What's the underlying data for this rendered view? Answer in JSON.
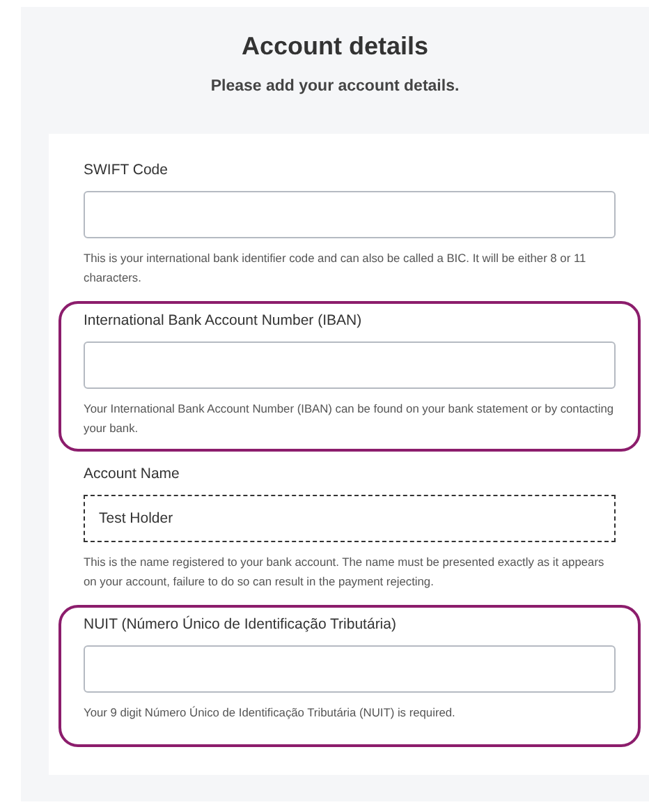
{
  "title": "Account details",
  "subtitle": "Please add your account details.",
  "fields": [
    {
      "label": "SWIFT Code",
      "help": "This is your international bank identifier code and can also be called a BIC. It will be either 8 or 11 characters.",
      "highlighted": false,
      "focused": false
    },
    {
      "label": "International Bank Account Number (IBAN)",
      "help": "Your International Bank Account Number (IBAN) can be found on your bank statement or by contacting your bank.",
      "highlighted": true,
      "focused": false
    },
    {
      "label": "Account Name",
      "value": "Test Holder",
      "help": "This is the name registered to your bank account. The name must be presented exactly as it appears on your account, failure to do so can result in the payment rejecting.",
      "highlighted": false,
      "focused": true
    },
    {
      "label": "NUIT (Número Único de Identificação Tributária)",
      "help": "Your 9 digit Número Único de Identificação Tributária (NUIT) is required.",
      "highlighted": true,
      "focused": false
    }
  ]
}
